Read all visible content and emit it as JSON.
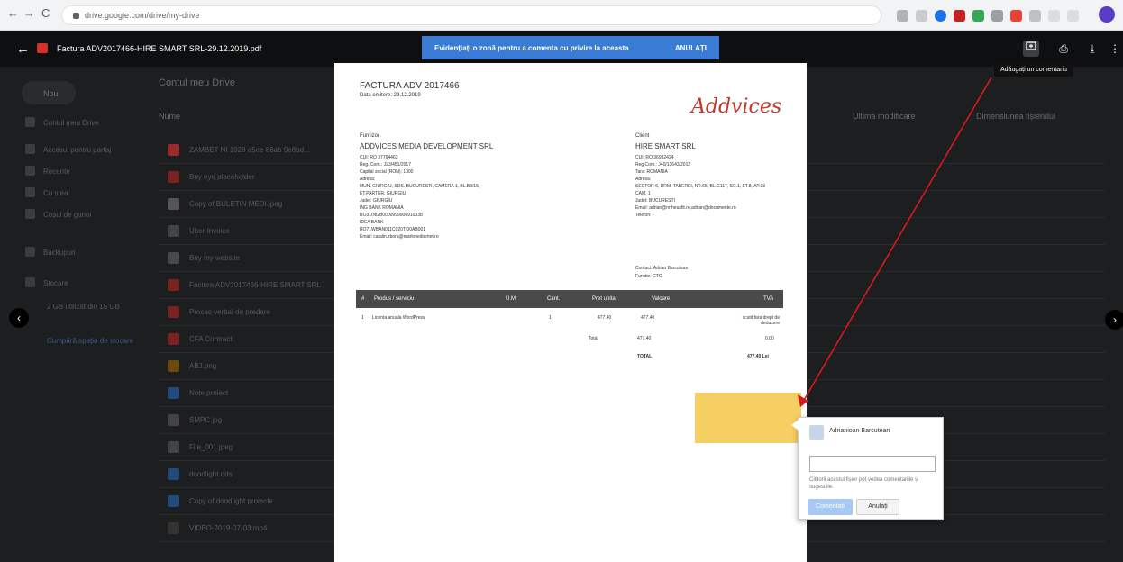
{
  "browser": {
    "url": "drive.google.com/drive/my-drive",
    "back_icon": "←",
    "forward_icon": "→",
    "reload_icon": "C"
  },
  "drive": {
    "breadcrumb": "Contul meu Drive",
    "new_label": "Nou",
    "col_name": "Nume",
    "col_modified": "Ultima modificare",
    "col_size": "Dimensiunea fișierului",
    "sidebar": [
      "Contul meu Drive",
      "Accesul pentru partaj",
      "Recente",
      "Cu stea",
      "Coșul de gunoi",
      "Backupuri",
      "Stocare"
    ],
    "storage_text": "2 GB utilizat din 15 GB",
    "buy_storage": "Cumpără spațiu de stocare",
    "files": [
      {
        "name": "ZAMBET NI 1928 a5ee 86ab 9e8bd...",
        "date": "",
        "size": ""
      },
      {
        "name": "Buy eye placeholder",
        "date": "",
        "size": ""
      },
      {
        "name": "Copy of BULETIN MEDI.jpeg",
        "date": "",
        "size": ""
      },
      {
        "name": "Uber Invoice",
        "date": "",
        "size": ""
      },
      {
        "name": "Buy my website",
        "date": "",
        "size": ""
      },
      {
        "name": "Factura ADV2017466-HIRE SMART SRL",
        "date": "",
        "size": ""
      },
      {
        "name": "Proces verbal de predare",
        "date": "",
        "size": ""
      },
      {
        "name": "CFA Contract",
        "date": "",
        "size": ""
      },
      {
        "name": "ABJ.png",
        "date": "",
        "size": ""
      },
      {
        "name": "Note proiect",
        "date": "",
        "size": ""
      },
      {
        "name": "SMPC.jpg",
        "date": "",
        "size": ""
      },
      {
        "name": "File_001.jpeg",
        "date": "",
        "size": ""
      },
      {
        "name": "doodlight.ods",
        "date": "",
        "size": ""
      },
      {
        "name": "Copy of doodlight proiecte",
        "date": "",
        "size": ""
      },
      {
        "name": "VIDEO-2019-07-03.mp4",
        "date": "",
        "size": ""
      }
    ]
  },
  "viewer": {
    "filename": "Factura ADV2017466-HIRE SMART SRL-29.12.2019.pdf",
    "banner_text": "Evidențiați o zonă pentru a comenta cu privire la aceasta",
    "banner_cancel": "ANULAȚI",
    "tooltip": "Adăugați un comentariu",
    "add_comment_icon": "add-comment-icon",
    "print_icon": "⎙",
    "download_icon": "⤓",
    "more_icon": "⋮",
    "prev_icon": "‹",
    "next_icon": "›"
  },
  "invoice": {
    "title": "FACTURA ADV 2017466",
    "date": "Data emitere: 29.12.2019",
    "logo": "Addvices",
    "supplier_label": "Furnizor",
    "supplier_name": "ADDVICES MEDIA DEVELOPMENT SRL",
    "supplier_lines": [
      "CUI: RO 37764463",
      "Reg. Com.: J23/451/2017",
      "Capital social (RON): 1000",
      "Adresa:",
      "MUN. GIURGIU, SOS. BUCURESTI, CAMERA 1, BL.B3/15,",
      "ET.PARTER, GIURGIU",
      "Judet: GIURGIU",
      "ING BANK ROMANIA",
      "RO31INGB0000999906910038",
      "IDEA BANK",
      "RO71WBAN011C020TI00AB001",
      "Email: catalin.zbora@markmediamet.ro"
    ],
    "client_label": "Client",
    "client_name": "HIRE SMART SRL",
    "client_lines": [
      "CUI: RO 36932424",
      "Reg.Com.: J40/13643/2012",
      "Tara: ROMANIA",
      "Adresa:",
      "SECTOR 6, DRM. TABEREI, NR.65, BL.G117, SC.1, ET.8, AP.33",
      "CAM. 1",
      "Judet: BUCURESTI",
      "Email: adrian@nrtheusfit.ro,adrian@documente.ro",
      "Telefon: -"
    ],
    "contact": "Contact: Adrian Barcutean",
    "function": "Functie: CTO",
    "table_headers": [
      "#",
      "Produs / serviciu",
      "U.M.",
      "Cant.",
      "Pret unitar",
      "Valoare",
      "TVA"
    ],
    "row": {
      "num": "1",
      "product": "Licenta anuala WordPress",
      "qty": "1",
      "price": "477.40",
      "value": "477.40",
      "vat": "scutit fara drept de deducere"
    },
    "total_label": "Total",
    "total_value": "477.40",
    "total_vat": "0.00",
    "grand_label": "TOTAL",
    "grand_value": "477.40 Lei"
  },
  "comment": {
    "user": "Adrianioan Barcutean",
    "input_value": "",
    "hint": "Cititorii acestui fișier pot vedea comentariile și sugestiile.",
    "post_label": "Comentați",
    "cancel_label": "Anulați"
  },
  "colors": {
    "banner": "#3a7bd5",
    "highlight": "#f6cf62",
    "annotation_arrow": "#d7191c",
    "logo": "#c0392b"
  }
}
